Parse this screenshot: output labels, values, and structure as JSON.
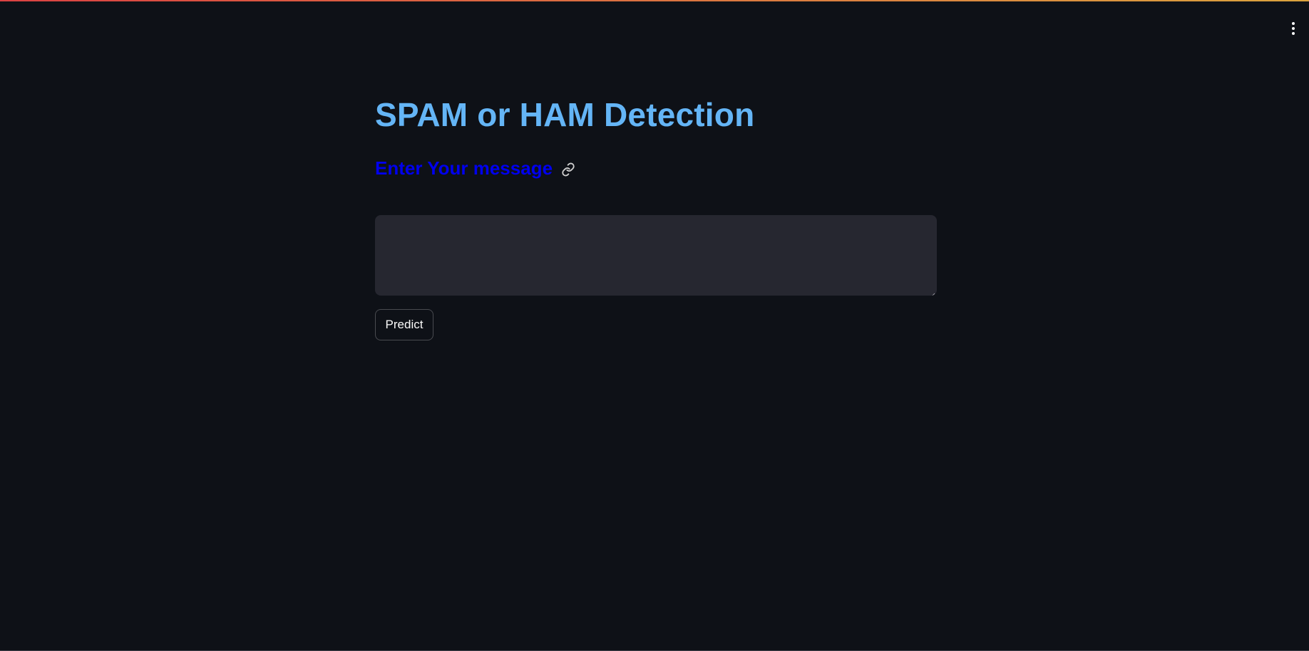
{
  "app": {
    "title": "SPAM or HAM Detection",
    "subheader": "Enter Your message",
    "menu_icon": "more-vertical-icon",
    "anchor_icon": "link-icon"
  },
  "form": {
    "message_value": "",
    "message_placeholder": "",
    "predict_label": "Predict"
  },
  "colors": {
    "background": "#0e1117",
    "title": "#64b5f6",
    "subheader": "#0000ee",
    "input_background": "#262730",
    "text": "#fafafa"
  }
}
